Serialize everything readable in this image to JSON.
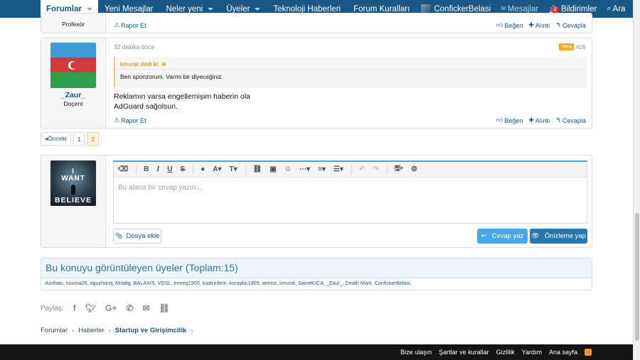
{
  "nav": {
    "tabs": [
      {
        "label": "Forumlar"
      },
      {
        "label": "Yeni Mesajlar"
      },
      {
        "label": "Neler yeni"
      },
      {
        "label": "Üyeler"
      },
      {
        "label": "Teknoloji Haberleri"
      },
      {
        "label": "Forum Kuralları"
      }
    ],
    "user": "ConfickerBelasi",
    "messages": "Mesajlar",
    "alerts": "Bildirimler",
    "alerts_count": "4",
    "search": "Ara"
  },
  "prev_post": {
    "user_title": "Profesör",
    "report": "Rapor Et",
    "like": "Beğen",
    "quote": "Alıntı",
    "reply": "Cevapla"
  },
  "post": {
    "time": "32 dakika önce",
    "new_badge": "Yeni",
    "number": "#26",
    "username": "_Zaur_",
    "user_title": "Doçent",
    "quote_author": "kmurat dedi ki:",
    "quote_text": "Ben sponzorum. Varmı bir diyeceğiniz.",
    "line1": "Reklamın varsa engellemişim haberin ola",
    "line2": "AdGuard sağolsun.",
    "report": "Rapor Et",
    "like": "Beğen",
    "quote": "Alıntı",
    "reply": "Cevapla"
  },
  "pager": {
    "prev": "◂Önceki",
    "pages": [
      "1",
      "2"
    ]
  },
  "avatar_text": {
    "line1": "I",
    "line2": "WANT",
    "line3": "BELIEVE"
  },
  "editor": {
    "placeholder": "Bu alana bir cevap yazın...",
    "attach": "Dosya ekle",
    "reply": "Cevap yaz",
    "preview": "Önizleme yap"
  },
  "viewers": {
    "title": "Bu konuyu görüntüleyen üyeler (Toplam:15)",
    "list": "dunfiato, nouma26, oguzhanq, Mrlaltg, BALAXIS, VDSL, emreg1905, kadirirdem, koraykic1905, atmrot, kmurat, SametUCA, _Zaur_, Death Mark, ConfickerBelasi,"
  },
  "share_label": "Paylaş:",
  "breadcrumb": [
    "Forumlar",
    "Haberler",
    "Startup ve Girişimcilik"
  ],
  "footer": [
    "Bize ulaşın",
    "Şartlar ve kurallar",
    "Gizlilik",
    "Yardım",
    "Ana sayfa"
  ]
}
